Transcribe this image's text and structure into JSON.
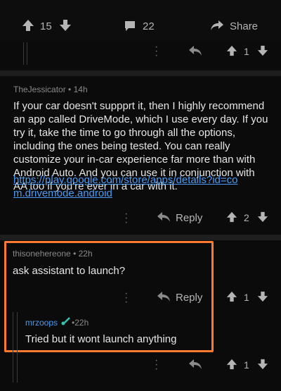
{
  "post_bar": {
    "upvotes": "15",
    "comments": "22",
    "share_label": "Share"
  },
  "top_collapsed": {
    "votes": "1"
  },
  "comment1": {
    "author": "TheJessicator",
    "age": "14h",
    "body": "If your car doesn't suppprt it, then I highly recommend an app called DriveMode, which I use every day. If you try it, take the time to go through all the options, including the ones being tested. You can really customize your in-car experience far more than with Android Auto. And you can use it in conjunction with AA too if you're ever in a car with it.",
    "link": "https://play.google.com/store/apps/details?id=com.drivemode.android",
    "reply_label": "Reply",
    "votes": "2"
  },
  "comment2": {
    "author": "thisonehereone",
    "age": "22h",
    "body": "ask assistant to launch?",
    "reply_label": "Reply",
    "votes": "1"
  },
  "comment3": {
    "author": "mrzoops",
    "age": "22h",
    "body": "Tried but it wont launch anything",
    "votes": "1"
  },
  "colors": {
    "highlight": "#ff7a2f",
    "link": "#4a9cf5",
    "flair": "#34c3b0"
  }
}
